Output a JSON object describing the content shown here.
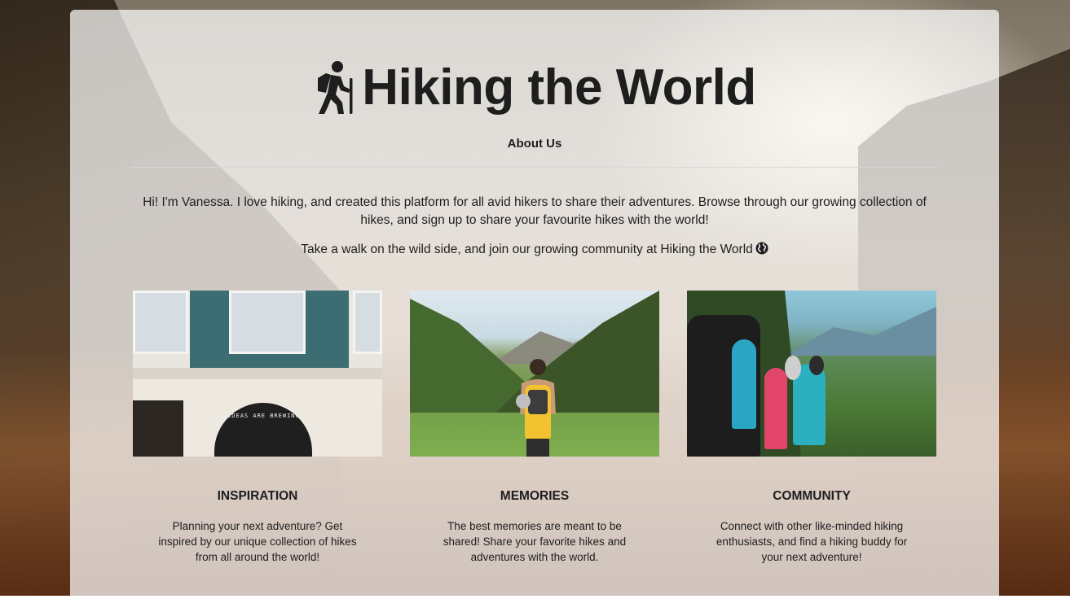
{
  "header": {
    "title": "Hiking the World",
    "title_icon": "hiking-person-icon",
    "about_link": "About Us"
  },
  "intro": {
    "text": "Hi! I'm Vanessa. I love hiking, and created this platform for all avid hikers to share their adventures. Browse through our growing collection of hikes, and sign up to share your favourite hikes with the world!",
    "tagline": "Take a walk on the wild side, and join our growing community at Hiking the World",
    "tagline_icon": "globe-icon"
  },
  "cards": [
    {
      "image": "building-photo",
      "sign_text": "IDEAS ARE BREWING.",
      "heading": "INSPIRATION",
      "text": "Planning your next adventure? Get inspired by our unique collection of hikes from all around the world!"
    },
    {
      "image": "valley-hiker-photo",
      "heading": "MEMORIES",
      "text": "The best memories are meant to be shared! Share your favorite hikes and adventures with the world."
    },
    {
      "image": "group-hike-photo",
      "heading": "COMMUNITY",
      "text": "Connect with other like-minded hiking enthusiasts, and find a hiking buddy for your next adventure!"
    }
  ],
  "colors": {
    "text": "#1e1e1e",
    "panel": "rgba(255,255,255,0.72)",
    "divider": "#d8d8d8"
  }
}
